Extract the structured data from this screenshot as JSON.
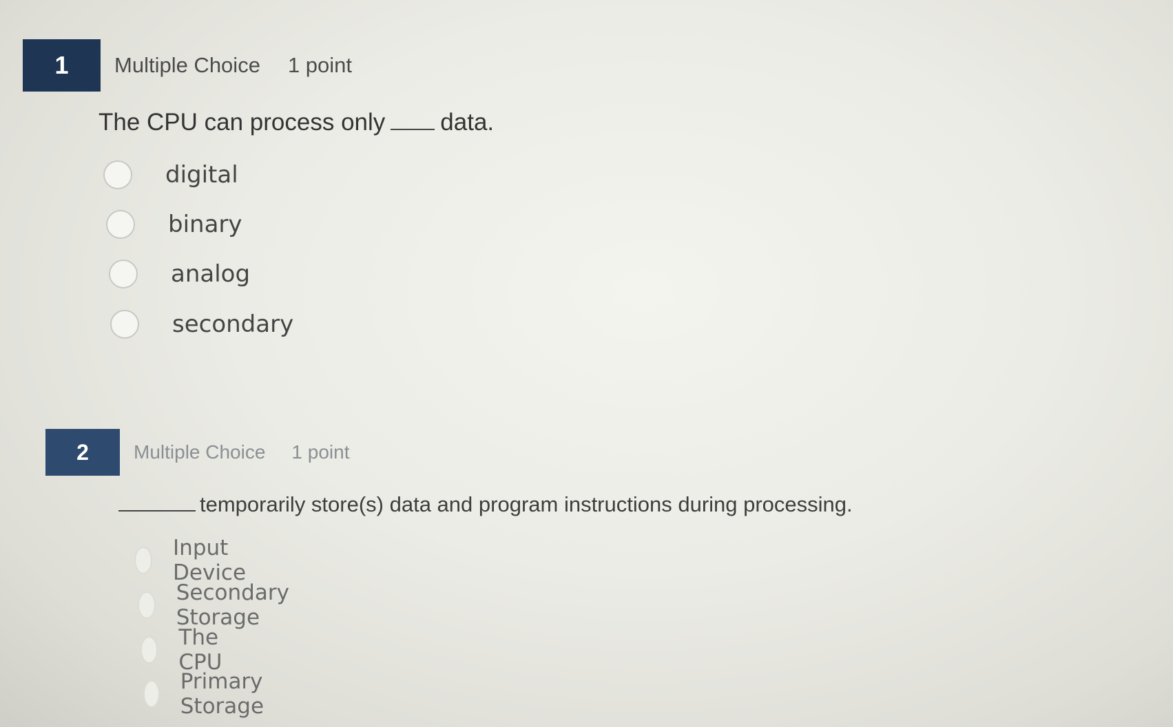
{
  "questions": [
    {
      "number": "1",
      "type": "Multiple Choice",
      "points": "1 point",
      "text_before": "The CPU can process only",
      "text_after": "data.",
      "options": [
        "digital",
        "binary",
        "analog",
        "secondary"
      ]
    },
    {
      "number": "2",
      "type": "Multiple Choice",
      "points": "1 point",
      "text_before": "",
      "text_after": "temporarily store(s) data and program instructions during processing.",
      "options": [
        "Input Device",
        "Secondary Storage",
        "The CPU",
        "Primary Storage"
      ]
    }
  ],
  "colors": {
    "question_number_bg": "#1f3554",
    "question_number_text": "#ffffff"
  }
}
